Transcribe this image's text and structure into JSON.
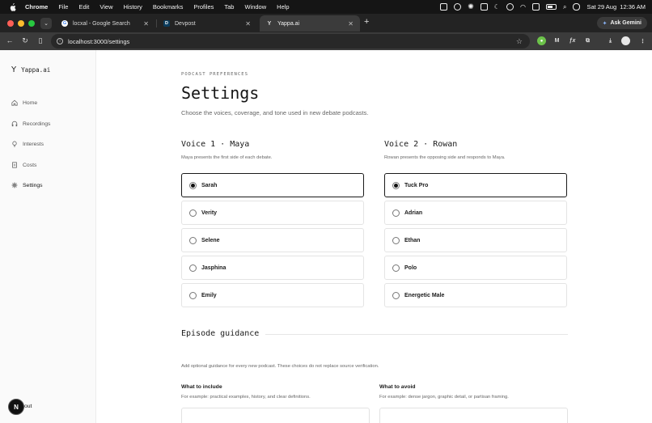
{
  "menubar": {
    "app": "Chrome",
    "menus": [
      "File",
      "Edit",
      "View",
      "History",
      "Bookmarks",
      "Profiles",
      "Tab",
      "Window",
      "Help"
    ],
    "clock": "Sat 29 Aug  12:36 AM"
  },
  "tabs": [
    {
      "title": "locxal - Google Search",
      "favicon": "G"
    },
    {
      "title": "Devpost",
      "favicon": "D"
    },
    {
      "title": "Yappa.ai",
      "favicon": "Y"
    }
  ],
  "ask_gemini": "Ask Gemini",
  "omnibox": {
    "url": "localhost:3000/settings"
  },
  "extensions": {
    "m": "M",
    "fx": "ƒx"
  },
  "sidebar": {
    "brand": "Yappa.ai",
    "items": [
      {
        "label": "Home",
        "icon": "home-icon"
      },
      {
        "label": "Recordings",
        "icon": "headphones-icon"
      },
      {
        "label": "Interests",
        "icon": "lightbulb-icon"
      },
      {
        "label": "Costs",
        "icon": "document-icon"
      },
      {
        "label": "Settings",
        "icon": "gear-icon"
      }
    ],
    "footer_badge": "N",
    "footer_label": "out"
  },
  "main": {
    "eyebrow": "PODCAST PREFERENCES",
    "title": "Settings",
    "subtitle": "Choose the voices, coverage, and tone used in new debate podcasts.",
    "voice1": {
      "heading": "Voice 1 · Maya",
      "description": "Maya presents the first side of each debate.",
      "options": [
        "Sarah",
        "Verity",
        "Selene",
        "Jasphina",
        "Emily"
      ],
      "selected": "Sarah"
    },
    "voice2": {
      "heading": "Voice 2 · Rowan",
      "description": "Rowan presents the opposing side and responds to Maya.",
      "options": [
        "Tuck Pro",
        "Adrian",
        "Ethan",
        "Polo",
        "Energetic Male"
      ],
      "selected": "Tuck Pro"
    },
    "guidance": {
      "heading": "Episode guidance",
      "description": "Add optional guidance for every new podcast. These choices do not replace source verification.",
      "include_label": "What to include",
      "include_hint": "For example: practical examples, history, and clear definitions.",
      "avoid_label": "What to avoid",
      "avoid_hint": "For example: dense jargon, graphic detail, or partisan framing."
    }
  }
}
